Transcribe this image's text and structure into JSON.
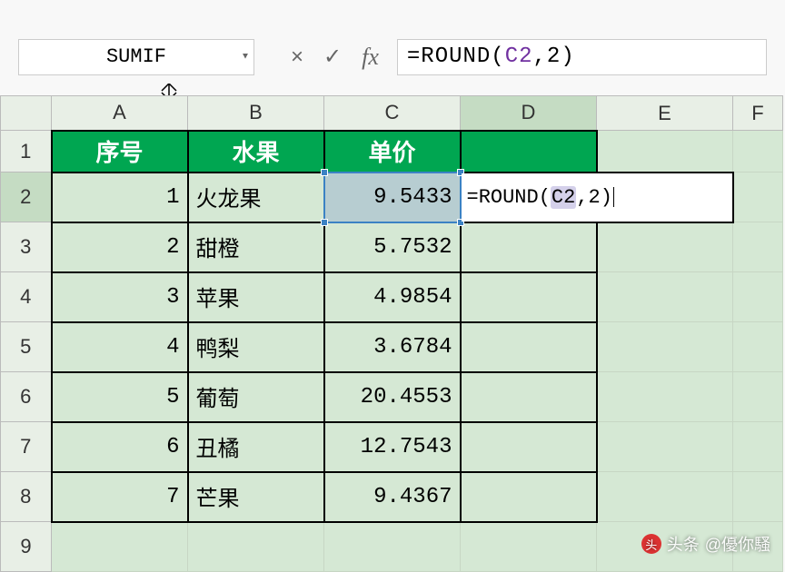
{
  "formula_bar": {
    "name_box": "SUMIF",
    "cancel_icon": "×",
    "confirm_icon": "✓",
    "fx_label": "fx",
    "formula_plain": "=ROUND(",
    "formula_ref": "C2",
    "formula_tail": ",2)"
  },
  "columns": {
    "A": "A",
    "B": "B",
    "C": "C",
    "D": "D",
    "E": "E",
    "F": "F"
  },
  "rows": {
    "r1": "1",
    "r2": "2",
    "r3": "3",
    "r4": "4",
    "r5": "5",
    "r6": "6",
    "r7": "7",
    "r8": "8",
    "r9": "9"
  },
  "header": {
    "seq": "序号",
    "fruit": "水果",
    "price": "单价"
  },
  "table": [
    {
      "seq": "1",
      "fruit": "火龙果",
      "price": "9.5433"
    },
    {
      "seq": "2",
      "fruit": "甜橙",
      "price": "5.7532"
    },
    {
      "seq": "3",
      "fruit": "苹果",
      "price": "4.9854"
    },
    {
      "seq": "4",
      "fruit": "鸭梨",
      "price": "3.6784"
    },
    {
      "seq": "5",
      "fruit": "葡萄",
      "price": "20.4553"
    },
    {
      "seq": "6",
      "fruit": "丑橘",
      "price": "12.7543"
    },
    {
      "seq": "7",
      "fruit": "芒果",
      "price": "9.4367"
    }
  ],
  "editing": {
    "prefix": "=ROUND(",
    "ref": "C2",
    "suffix": ",2)"
  },
  "watermark": {
    "label": "头条",
    "handle": "@優你騷"
  }
}
